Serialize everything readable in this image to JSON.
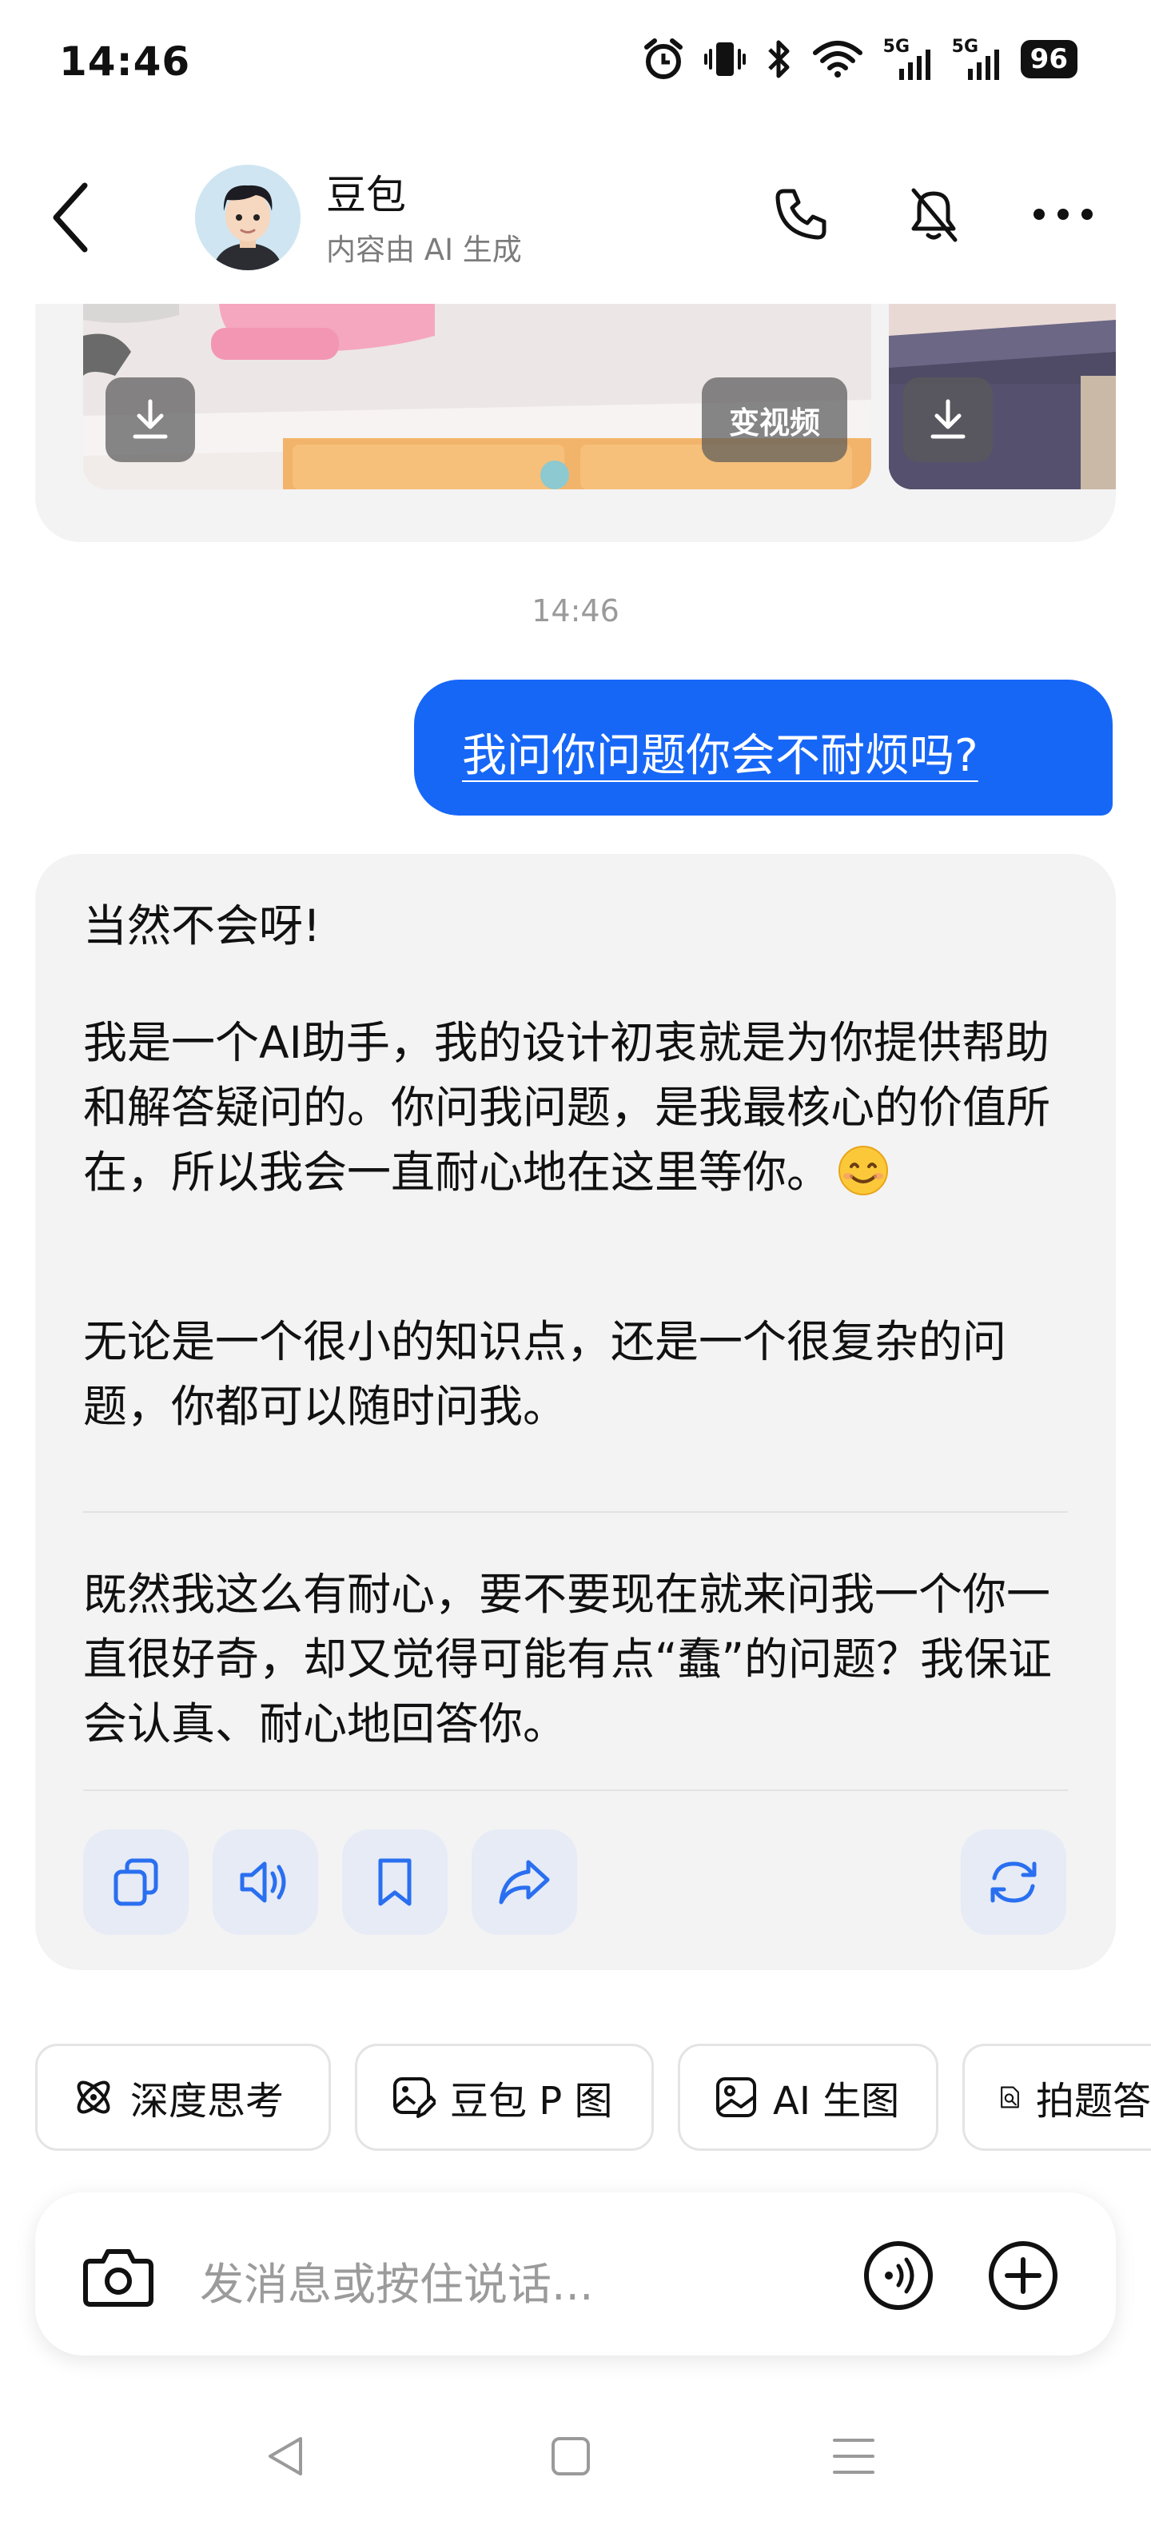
{
  "status_bar": {
    "time": "14:46",
    "icons": [
      "alarm-icon",
      "vibrate-icon",
      "bluetooth-icon",
      "wifi-icon",
      "signal-5g-icon",
      "signal-5g-icon"
    ],
    "network_label_1": "5G",
    "network_label_2": "5G",
    "battery": "96"
  },
  "header": {
    "name": "豆包",
    "subtitle": "内容由 AI 生成",
    "icons": [
      "back-icon",
      "phone-icon",
      "mute-icon",
      "more-icon"
    ]
  },
  "image_card": {
    "to_video_label": "变视频"
  },
  "timestamp": "14:46",
  "user_message": "我问你问题你会不耐烦吗?",
  "bot_message": {
    "p1": "当然不会呀!",
    "p2": "我是一个AI助手，我的设计初衷就是为你提供帮助和解答疑问的。你问我问题，是我最核心的价值所在，所以我会一直耐心地在这里等你。",
    "p2_emoji": "smiling-face-emoji",
    "p3": "无论是一个很小的知识点，还是一个很复杂的问题，你都可以随时问我。",
    "p4": "既然我这么有耐心，要不要现在就来问我一个你一直很好奇，却又觉得可能有点“蠢”的问题？我保证会认真、耐心地回答你。"
  },
  "bot_actions": [
    "copy-icon",
    "speaker-icon",
    "bookmark-icon",
    "share-icon",
    "regenerate-icon"
  ],
  "chips": [
    {
      "label": "深度思考",
      "icon": "atom-icon"
    },
    {
      "label": "豆包 P 图",
      "icon": "edit-image-icon"
    },
    {
      "label": "AI 生图",
      "icon": "image-icon"
    },
    {
      "label": "拍题答",
      "icon": "scan-doc-icon"
    }
  ],
  "input": {
    "placeholder": "发消息或按住说话..."
  },
  "colors": {
    "user_bubble": "#1767f7",
    "bot_bubble": "#f3f3f4",
    "action_button": "#e6ebf6",
    "accent_icon": "#2a6ff0"
  }
}
